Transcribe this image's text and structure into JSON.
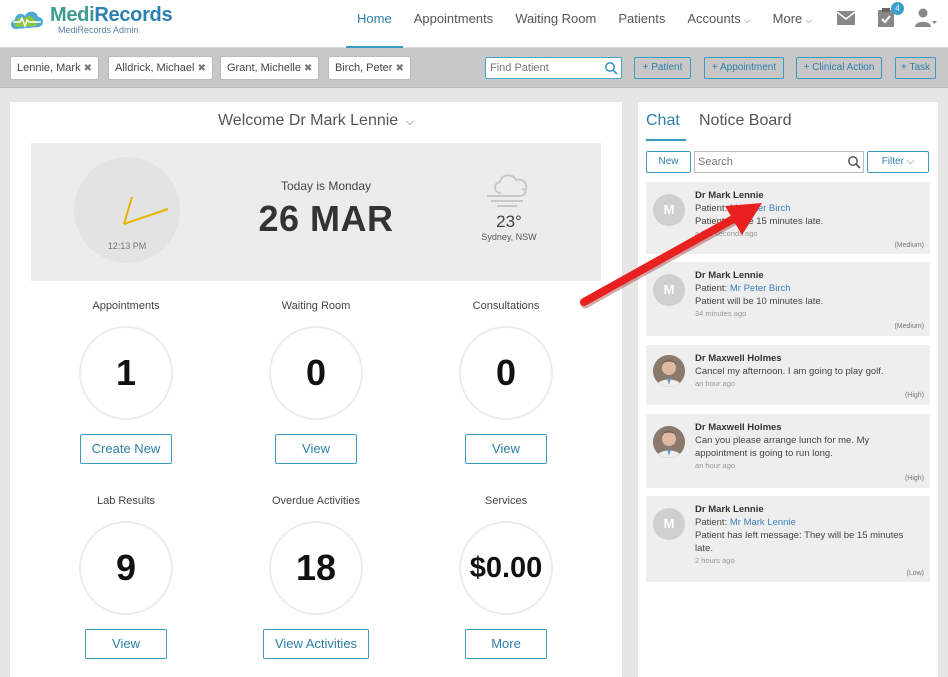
{
  "brand": {
    "name_part1": "Medi",
    "name_part2": "Records",
    "subtitle": "MediRecords Admin"
  },
  "nav": {
    "items": [
      {
        "label": "Home",
        "active": true
      },
      {
        "label": "Appointments"
      },
      {
        "label": "Waiting Room"
      },
      {
        "label": "Patients"
      },
      {
        "label": "Accounts",
        "dropdown": true
      },
      {
        "label": "More",
        "dropdown": true
      }
    ],
    "icons": {
      "mail": "envelope-icon",
      "tasks": "clipboard-check-icon",
      "tasks_badge": "4",
      "user": "user-icon"
    }
  },
  "patient_tabs": [
    {
      "label": "Lennie, Mark"
    },
    {
      "label": "Alldrick, Michael"
    },
    {
      "label": "Grant, Michelle"
    },
    {
      "label": "Birch, Peter"
    }
  ],
  "toolbar": {
    "find_placeholder": "Find Patient",
    "buttons": [
      "+ Patient",
      "+ Appointment",
      "+ Clinical Action",
      "+ Task"
    ]
  },
  "welcome": {
    "text": "Welcome Dr Mark Lennie"
  },
  "hero": {
    "clock_time": "12:13 PM",
    "today_label": "Today is Monday",
    "date": "26 MAR",
    "weather_icon": "cloud-wind-icon",
    "temperature": "23°",
    "location": "Sydney, NSW"
  },
  "stats": [
    {
      "label": "Appointments",
      "value": "1",
      "button": "Create New"
    },
    {
      "label": "Waiting Room",
      "value": "0",
      "button": "View"
    },
    {
      "label": "Consultations",
      "value": "0",
      "button": "View"
    },
    {
      "label": "Lab Results",
      "value": "9",
      "button": "View"
    },
    {
      "label": "Overdue Activities",
      "value": "18",
      "button": "View Activities"
    },
    {
      "label": "Services",
      "value": "$0.00",
      "button": "More"
    }
  ],
  "side": {
    "tabs": [
      {
        "label": "Chat",
        "active": true
      },
      {
        "label": "Notice Board"
      }
    ],
    "new_label": "New",
    "search_placeholder": "Search",
    "filter_label": "Filter"
  },
  "messages": [
    {
      "avatar": "M",
      "name": "Dr Mark Lennie",
      "patient_prefix": "Patient: ",
      "patient": "Mr Peter Birch",
      "text": "Patient will be 15 minutes late.",
      "time": "a few seconds ago",
      "priority": "(Medium)"
    },
    {
      "avatar": "M",
      "name": "Dr Mark Lennie",
      "patient_prefix": "Patient: ",
      "patient": "Mr Peter Birch",
      "text": "Patient will be 10 minutes late.",
      "time": "34 minutes ago",
      "priority": "(Medium)"
    },
    {
      "avatar": "",
      "name": "Dr Maxwell Holmes",
      "text": "Cancel my afternoon. I am going to play golf.",
      "time": "an hour ago",
      "priority": "(High)"
    },
    {
      "avatar": "",
      "name": "Dr Maxwell Holmes",
      "text1": "Can you please arrange lunch for me. My",
      "text2": "appointment is going to run long.",
      "time": "an hour ago",
      "priority": "(High)"
    },
    {
      "avatar": "M",
      "name": "Dr Mark Lennie",
      "patient_prefix": "Patient: ",
      "patient": "Mr Mark Lennie",
      "text1": "Patient has left message: They will be 15 minutes",
      "text2": "late.",
      "time": "2 hours ago",
      "priority": "(Low)"
    }
  ],
  "colors": {
    "accent": "#2d7fa9",
    "brand_green": "#3d9b8f",
    "annotation_arrow": "#e8201f",
    "clock_hands": "#e8b400"
  }
}
